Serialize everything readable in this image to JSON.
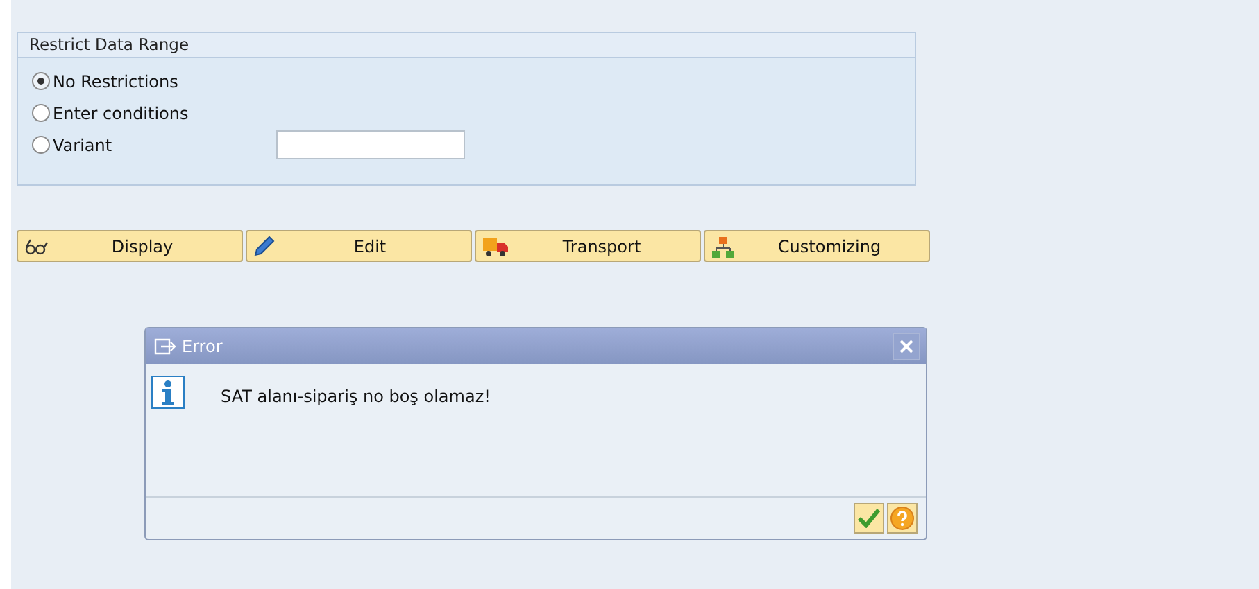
{
  "group": {
    "title": "Restrict Data Range",
    "options": [
      {
        "label": "No Restrictions",
        "selected": true,
        "kind": "plain"
      },
      {
        "label": "Enter conditions",
        "selected": false,
        "kind": "plain"
      },
      {
        "label": "Variant",
        "selected": false,
        "kind": "field"
      }
    ]
  },
  "buttons": [
    {
      "label": "Display",
      "kind": "glasses"
    },
    {
      "label": "Edit",
      "kind": "pencil"
    },
    {
      "label": "Transport",
      "kind": "truck"
    },
    {
      "label": "Customizing",
      "kind": "hierarchy"
    }
  ],
  "dialog": {
    "title": "Error",
    "message": "SAT alanı-sipariş no boş olamaz!"
  }
}
